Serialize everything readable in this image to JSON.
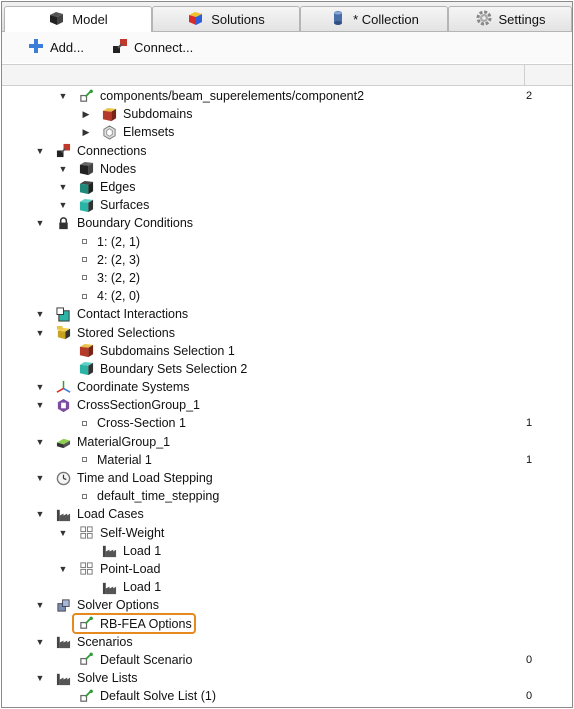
{
  "tabs": [
    {
      "label": "Model",
      "icon": "model-icon"
    },
    {
      "label": "Solutions",
      "icon": "solutions-icon"
    },
    {
      "label": "* Collection",
      "icon": "collection-icon"
    },
    {
      "label": "Settings",
      "icon": "gear-icon"
    }
  ],
  "toolbar": {
    "add_label": "Add...",
    "connect_label": "Connect..."
  },
  "tree": [
    {
      "label": "components/beam_superelements/component2",
      "level": 1,
      "expander": "down",
      "icon": "component-icon",
      "count": "2"
    },
    {
      "label": "Subdomains",
      "level": 2,
      "expander": "right",
      "icon": "subdomain-cube-icon",
      "count": ""
    },
    {
      "label": "Elemsets",
      "level": 2,
      "expander": "right",
      "icon": "elemset-icon",
      "count": ""
    },
    {
      "label": "Connections",
      "level": 0,
      "expander": "down",
      "icon": "connections-icon",
      "count": ""
    },
    {
      "label": "Nodes",
      "level": 1,
      "expander": "down",
      "icon": "nodes-cube-icon",
      "count": ""
    },
    {
      "label": "Edges",
      "level": 1,
      "expander": "down",
      "icon": "edges-cube-icon",
      "count": ""
    },
    {
      "label": "Surfaces",
      "level": 1,
      "expander": "down",
      "icon": "surfaces-cube-icon",
      "count": ""
    },
    {
      "label": "Boundary Conditions",
      "level": 0,
      "expander": "down",
      "icon": "lock-icon",
      "count": ""
    },
    {
      "label": "1: (2, 1)",
      "level": 1,
      "expander": "none",
      "icon": "leaf-square",
      "count": ""
    },
    {
      "label": "2: (2, 3)",
      "level": 1,
      "expander": "none",
      "icon": "leaf-square",
      "count": ""
    },
    {
      "label": "3: (2, 2)",
      "level": 1,
      "expander": "none",
      "icon": "leaf-square",
      "count": ""
    },
    {
      "label": "4: (2, 0)",
      "level": 1,
      "expander": "none",
      "icon": "leaf-square",
      "count": ""
    },
    {
      "label": "Contact Interactions",
      "level": 0,
      "expander": "down",
      "icon": "contact-icon",
      "count": ""
    },
    {
      "label": "Stored Selections",
      "level": 0,
      "expander": "down",
      "icon": "stored-selections-icon",
      "count": ""
    },
    {
      "label": "Subdomains Selection 1",
      "level": 1,
      "expander": "none",
      "icon": "subdomain-cube-icon",
      "count": ""
    },
    {
      "label": "Boundary Sets Selection 2",
      "level": 1,
      "expander": "none",
      "icon": "surfaces-cube-icon",
      "count": ""
    },
    {
      "label": "Coordinate Systems",
      "level": 0,
      "expander": "down",
      "icon": "axes-icon",
      "count": ""
    },
    {
      "label": "CrossSectionGroup_1",
      "level": 0,
      "expander": "down",
      "icon": "cross-section-icon",
      "count": ""
    },
    {
      "label": "Cross-Section 1",
      "level": 1,
      "expander": "none",
      "icon": "leaf-square",
      "count": "1"
    },
    {
      "label": "MaterialGroup_1",
      "level": 0,
      "expander": "down",
      "icon": "material-icon",
      "count": ""
    },
    {
      "label": "Material 1",
      "level": 1,
      "expander": "none",
      "icon": "leaf-square",
      "count": "1"
    },
    {
      "label": "Time and Load Stepping",
      "level": 0,
      "expander": "down",
      "icon": "clock-icon",
      "count": ""
    },
    {
      "label": "default_time_stepping",
      "level": 1,
      "expander": "none",
      "icon": "leaf-square",
      "count": ""
    },
    {
      "label": "Load Cases",
      "level": 0,
      "expander": "down",
      "icon": "factory-icon",
      "count": ""
    },
    {
      "label": "Self-Weight",
      "level": 1,
      "expander": "down",
      "icon": "grid-icon",
      "count": ""
    },
    {
      "label": "Load 1",
      "level": 2,
      "expander": "none",
      "icon": "factory-icon",
      "count": ""
    },
    {
      "label": "Point-Load",
      "level": 1,
      "expander": "down",
      "icon": "grid-icon",
      "count": ""
    },
    {
      "label": "Load 1",
      "level": 2,
      "expander": "none",
      "icon": "factory-icon",
      "count": ""
    },
    {
      "label": "Solver Options",
      "level": 0,
      "expander": "down",
      "icon": "solver-icon",
      "count": ""
    },
    {
      "label": "RB-FEA Options",
      "level": 1,
      "expander": "none",
      "icon": "component-icon",
      "count": "",
      "highlighted": true
    },
    {
      "label": "Scenarios",
      "level": 0,
      "expander": "down",
      "icon": "factory-icon",
      "count": ""
    },
    {
      "label": "Default Scenario",
      "level": 1,
      "expander": "none",
      "icon": "component-icon",
      "count": "0"
    },
    {
      "label": "Solve Lists",
      "level": 0,
      "expander": "down",
      "icon": "factory-icon",
      "count": ""
    },
    {
      "label": "Default Solve List (1)",
      "level": 1,
      "expander": "none",
      "icon": "component-icon",
      "count": "0"
    }
  ],
  "colors": {
    "highlight": "#e8891e"
  }
}
